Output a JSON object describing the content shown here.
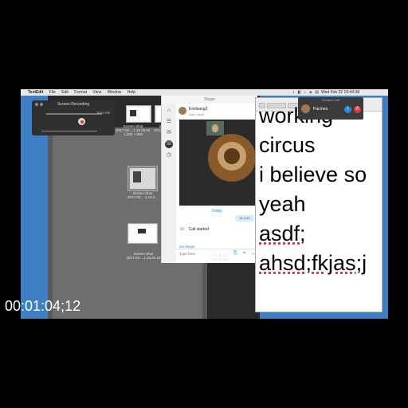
{
  "menubar": {
    "apple": "",
    "app_name": "TextEdit",
    "items": [
      "File",
      "Edit",
      "Format",
      "View",
      "Window",
      "Help"
    ],
    "clock": "Wed Feb 22  16:44:38",
    "status_icons": "◐ ◧ ⌂ ◈ ▤"
  },
  "recorder": {
    "title": "Screen Recording",
    "size": "Zero KB"
  },
  "finder": {
    "shots": [
      {
        "name": "Screen Shot",
        "date": "2017-02-...1.16.36.54",
        "dims": "1,280 × 800"
      },
      {
        "name": "Screen Shot",
        "date": "2017-02-...1.16.3..."
      },
      {
        "name": "Screen Shot",
        "date": "2017-02-...1.16.3..."
      },
      {
        "name": "Screen Shot",
        "date": "2017-03-...1.16.34.20"
      }
    ],
    "strip": [
      "...1.16.31.20",
      "...1.16.29.06"
    ]
  },
  "skype": {
    "window_title": "Skype",
    "contact_name": "Emilsang3",
    "contact_sub": "Add Credit",
    "today": "Today",
    "bubble": "6s 4:20",
    "call_started": "Call started",
    "mention": "via Skype",
    "type_placeholder": "Type here",
    "icons": {
      "home": "⌂",
      "contacts": "☰",
      "chat": "✉",
      "calls": "☏",
      "history": "◷"
    }
  },
  "textedit": {
    "lines": [
      "working",
      "circus",
      "i believe so",
      "yeah",
      "asdf;",
      "ahsd;fkjas;j"
    ]
  },
  "current_call": {
    "title": "Current Call",
    "name": "Parches",
    "info_label": "i",
    "hangup_label": "✆"
  },
  "timecode": "00:01:04;12"
}
